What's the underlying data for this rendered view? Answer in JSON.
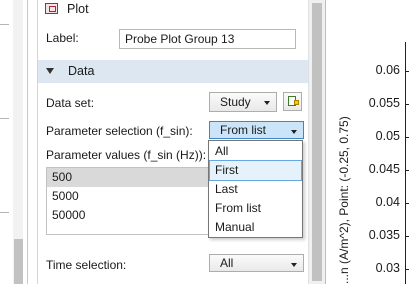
{
  "panel": {
    "title": "Plot",
    "label_caption": "Label:",
    "label_value": "Probe Plot Group 13",
    "section_title": "Data",
    "data_set_caption": "Data set:",
    "data_set_value": "Study",
    "param_selection_caption": "Parameter selection (f_sin):",
    "param_selection_value": "From list",
    "param_values_caption": "Parameter values (f_sin (Hz)):",
    "param_values": [
      "500",
      "5000",
      "50000"
    ],
    "time_selection_caption": "Time selection:",
    "time_selection_value": "All"
  },
  "dropdown": {
    "options": [
      "All",
      "First",
      "Last",
      "From list",
      "Manual"
    ],
    "highlighted": "First"
  },
  "chart_data": {
    "type": "line",
    "ylabel": "...n (A/m^2), Point: (-0.25, 0.75)",
    "yticks": [
      "0.06",
      "0.055",
      "0.05",
      "0.045",
      "0.04",
      "0.035",
      "0.03"
    ]
  }
}
